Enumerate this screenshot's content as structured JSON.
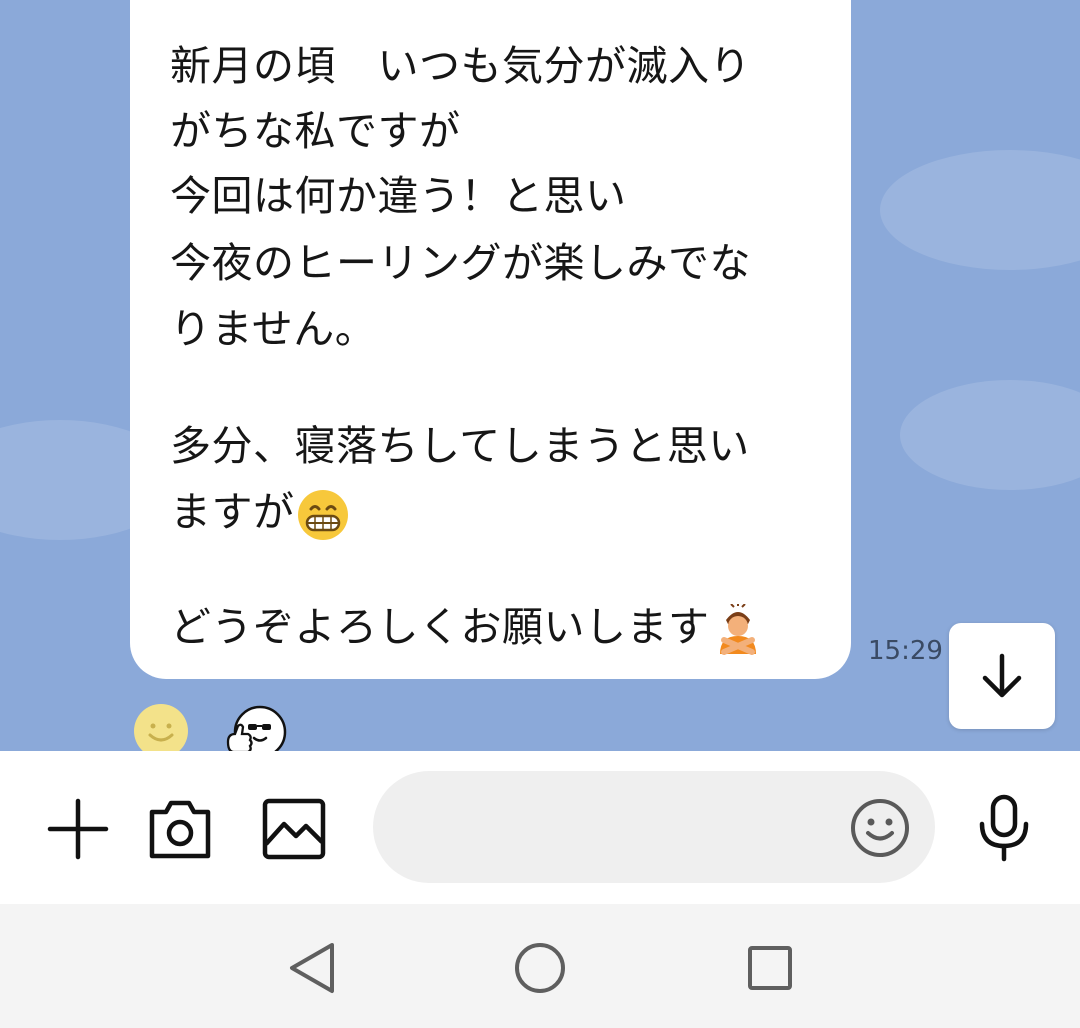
{
  "message": {
    "lines": [
      "新月の頃　いつも気分が滅入り",
      "がちな私ですが",
      "今回は何か違う！と思い",
      "今夜のヒーリングが楽しみでな",
      "りません。",
      "",
      "多分、寝落ちしてしまうと思い",
      "ますが",
      "",
      "どうぞよろしくお願いします"
    ],
    "time": "15:29",
    "inline_emojis": [
      "grinning-face-emoji",
      "person-gesturing-no-emoji"
    ]
  },
  "reactions": [
    "smiley-reaction-icon",
    "thumbs-up-sticker-icon"
  ],
  "input": {
    "placeholder": "",
    "value": ""
  },
  "toolbar_icons": [
    "plus-icon",
    "camera-icon",
    "image-icon",
    "emoji-icon",
    "microphone-icon"
  ],
  "nav_icons": [
    "back-icon",
    "home-icon",
    "recents-icon"
  ],
  "colors": {
    "chat_background": "#8ba9d9",
    "bubble": "#ffffff",
    "input_background": "#efefef",
    "nav_background": "#f4f4f4"
  }
}
